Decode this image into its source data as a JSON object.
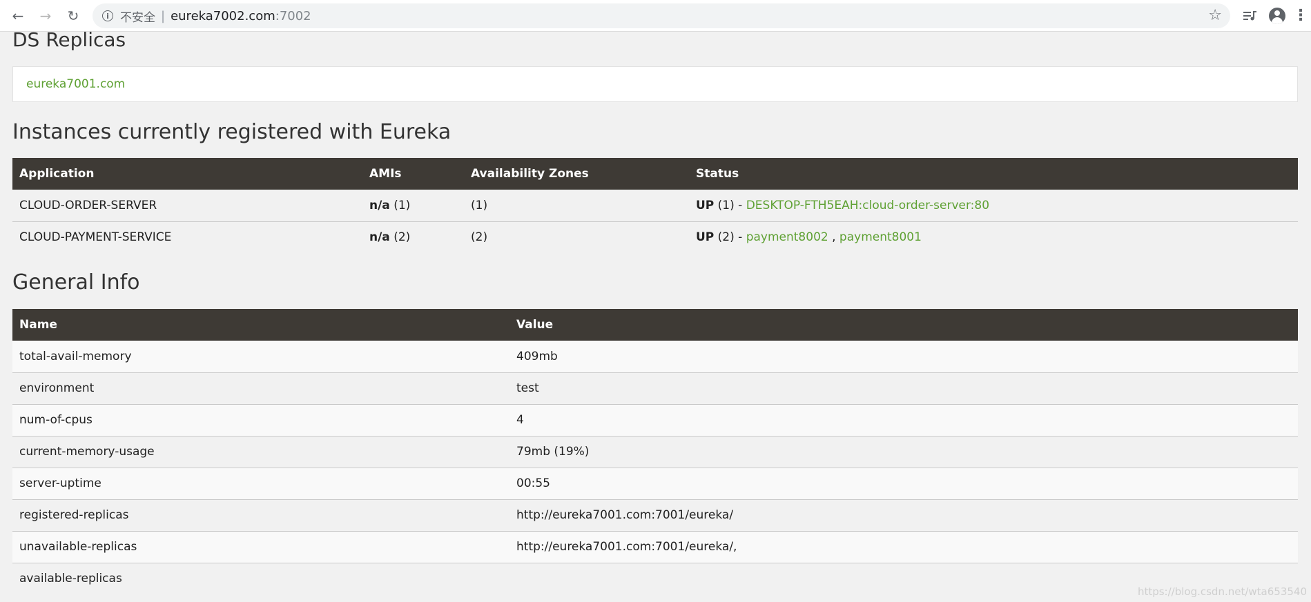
{
  "browser": {
    "security_label": "不安全",
    "separator": "|",
    "host": "eureka7002.com",
    "port": ":7002"
  },
  "ds_replicas": {
    "title": "DS Replicas",
    "link": "eureka7001.com"
  },
  "instances": {
    "title": "Instances currently registered with Eureka",
    "columns": [
      "Application",
      "AMIs",
      "Availability Zones",
      "Status"
    ],
    "rows": [
      {
        "application": "CLOUD-ORDER-SERVER",
        "amis_bold": "n/a",
        "amis_count": " (1)",
        "zones": "(1)",
        "status_state": "UP",
        "status_count": " (1) - ",
        "status_links": [
          "DESKTOP-FTH5EAH:cloud-order-server:80"
        ]
      },
      {
        "application": "CLOUD-PAYMENT-SERVICE",
        "amis_bold": "n/a",
        "amis_count": " (2)",
        "zones": "(2)",
        "status_state": "UP",
        "status_count": " (2) - ",
        "status_links": [
          "payment8002",
          "payment8001"
        ],
        "link_separator": " , "
      }
    ]
  },
  "general_info": {
    "title": "General Info",
    "columns": [
      "Name",
      "Value"
    ],
    "rows": [
      {
        "name": "total-avail-memory",
        "value": "409mb"
      },
      {
        "name": "environment",
        "value": "test"
      },
      {
        "name": "num-of-cpus",
        "value": "4"
      },
      {
        "name": "current-memory-usage",
        "value": "79mb (19%)"
      },
      {
        "name": "server-uptime",
        "value": "00:55"
      },
      {
        "name": "registered-replicas",
        "value": "http://eureka7001.com:7001/eureka/"
      },
      {
        "name": "unavailable-replicas",
        "value": "http://eureka7001.com:7001/eureka/,"
      },
      {
        "name": "available-replicas",
        "value": ""
      }
    ]
  },
  "watermark": "https://blog.csdn.net/wta653540",
  "colors": {
    "link": "#5fa134",
    "table_header_bg": "#3e3a35",
    "page_bg": "#f1f1f1"
  }
}
